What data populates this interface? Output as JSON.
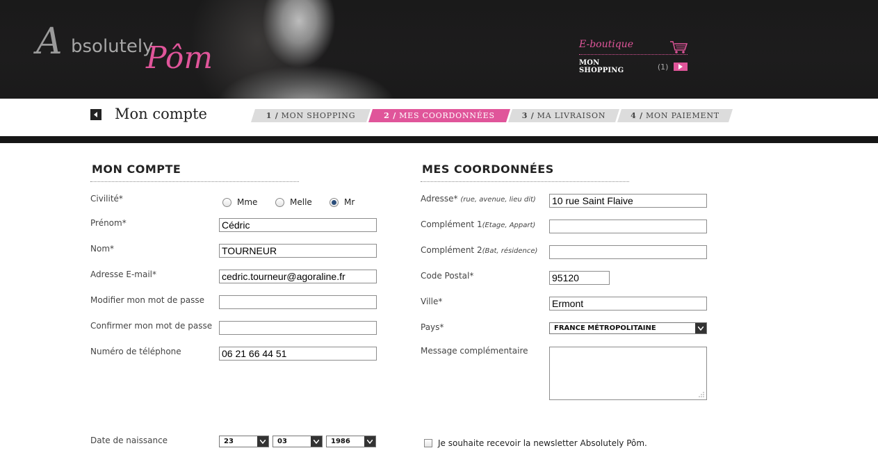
{
  "header": {
    "logo_part1": "A",
    "logo_part1b": "bsolutely",
    "logo_part2": "Pôm",
    "eboutique": "E-boutique",
    "mon_shopping": "MON SHOPPING",
    "cart_count": "(1)",
    "accent": "#e0559a"
  },
  "stepbar": {
    "title": "Mon compte",
    "steps": [
      {
        "num": "1 /",
        "label": "MON SHOPPING"
      },
      {
        "num": "2 /",
        "label": "MES COORDONNÉES"
      },
      {
        "num": "3 /",
        "label": "MA LIVRAISON"
      },
      {
        "num": "4 /",
        "label": "MON PAIEMENT"
      }
    ],
    "active_step": 2
  },
  "account": {
    "heading": "MON COMPTE",
    "civilite_label": "Civilité*",
    "civilite_options": [
      "Mme",
      "Melle",
      "Mr"
    ],
    "civilite_selected": "Mr",
    "prenom_label": "Prénom*",
    "prenom_value": "Cédric",
    "nom_label": "Nom*",
    "nom_value": "TOURNEUR",
    "email_label": "Adresse E-mail*",
    "email_value": "cedric.tourneur@agoraline.fr",
    "pwd_label": "Modifier mon mot de passe",
    "pwd_value": "",
    "pwd_confirm_label": "Confirmer mon mot de passe",
    "pwd_confirm_value": "",
    "phone_label": "Numéro de téléphone",
    "phone_value": "06 21 66 44 51",
    "birth_label": "Date de naissance",
    "birth_day": "23",
    "birth_month": "03",
    "birth_year": "1986"
  },
  "coords": {
    "heading": "MES COORDONNÉES",
    "adresse_label": "Adresse*",
    "adresse_hint": "(rue, avenue, lieu dit)",
    "adresse_value": "10 rue Saint Flaive",
    "comp1_label": "Complément 1",
    "comp1_hint": "(Etage, Appart)",
    "comp1_value": "",
    "comp2_label": "Complément 2",
    "comp2_hint": "(Bat, résidence)",
    "comp2_value": "",
    "cp_label": "Code Postal*",
    "cp_value": "95120",
    "ville_label": "Ville*",
    "ville_value": "Ermont",
    "pays_label": "Pays*",
    "pays_value": "FRANCE MÉTROPOLITAINE",
    "message_label": "Message complémentaire",
    "message_value": "",
    "newsletter_label": "Je souhaite recevoir la newsletter Absolutely Pôm."
  }
}
